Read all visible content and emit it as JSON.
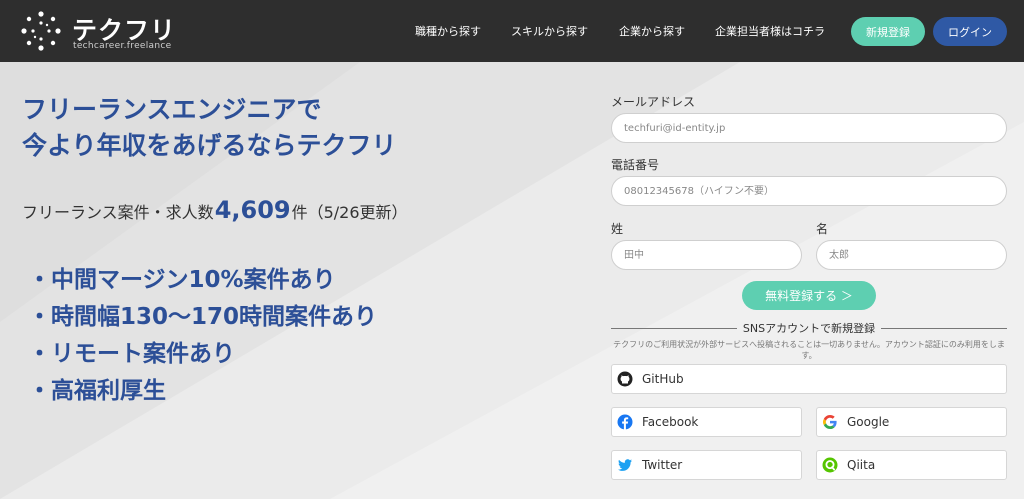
{
  "header": {
    "logo_text": "テクフリ",
    "logo_sub": "techcareer.freelance",
    "nav": [
      "職種から探す",
      "スキルから探す",
      "企業から探す",
      "企業担当者様はコチラ"
    ],
    "signup_label": "新規登録",
    "login_label": "ログイン"
  },
  "hero": {
    "title_line1": "フリーランスエンジニアで",
    "title_line2": "今より年収をあげるならテクフリ",
    "count_prefix": "フリーランス案件・求人数",
    "count_value": "4,609",
    "count_suffix": "件（5/26更新）",
    "bullets": [
      "・中間マージン10%案件あり",
      "・時間幅130〜170時間案件あり",
      "・リモート案件あり",
      "・高福利厚生"
    ]
  },
  "form": {
    "email_label": "メールアドレス",
    "email_placeholder": "techfuri@id-entity.jp",
    "phone_label": "電話番号",
    "phone_placeholder": "08012345678（ハイフン不要）",
    "last_name_label": "姓",
    "last_name_placeholder": "田中",
    "first_name_label": "名",
    "first_name_placeholder": "太郎",
    "submit_label": "無料登録する ＞"
  },
  "sns": {
    "title": "SNSアカウントで新規登録",
    "note": "テクフリのご利用状況が外部サービスへ投稿されることは一切ありません。アカウント認証にのみ利用をします。",
    "github": "GitHub",
    "facebook": "Facebook",
    "google": "Google",
    "twitter": "Twitter",
    "qiita": "Qiita"
  },
  "colors": {
    "header_bg": "#2e2e2e",
    "accent_green": "#5ecfb1",
    "accent_blue": "#2f59a5",
    "hero_text": "#2c4f97"
  }
}
